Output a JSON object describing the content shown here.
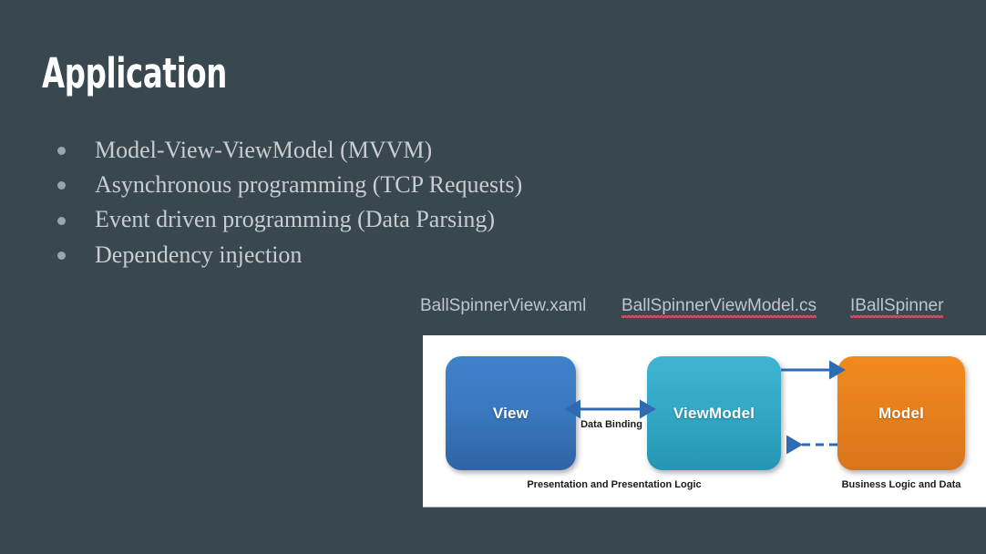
{
  "slide": {
    "title": "Application",
    "background_color": "#39474f"
  },
  "bullets": [
    {
      "text": "Model-View-ViewModel (MVVM)"
    },
    {
      "text": "Asynchronous programming (TCP Requests)"
    },
    {
      "text": "Event driven programming (Data Parsing)"
    },
    {
      "text": "Dependency injection"
    }
  ],
  "file_labels": [
    {
      "text": "BallSpinnerView.xaml",
      "misspelled": false
    },
    {
      "text": "BallSpinnerViewModel.cs",
      "misspelled": true
    },
    {
      "text": "IBallSpinner",
      "misspelled": true
    }
  ],
  "diagram": {
    "nodes": [
      {
        "id": "view",
        "label": "View",
        "color": "#3a79c1"
      },
      {
        "id": "viewmodel",
        "label": "ViewModel",
        "color": "#34a9c6"
      },
      {
        "id": "model",
        "label": "Model",
        "color": "#e8811d"
      }
    ],
    "arrows": [
      {
        "id": "data-binding",
        "label": "Data Binding",
        "style": "solid",
        "direction": "both"
      },
      {
        "id": "vm-to-model",
        "label": "",
        "style": "solid",
        "direction": "right"
      },
      {
        "id": "model-to-vm",
        "label": "",
        "style": "dashed",
        "direction": "left"
      }
    ],
    "captions": [
      {
        "id": "presentation",
        "text": "Presentation and Presentation Logic"
      },
      {
        "id": "business",
        "text": "Business Logic and Data"
      }
    ],
    "arrow_color": "#2f6bb0"
  }
}
